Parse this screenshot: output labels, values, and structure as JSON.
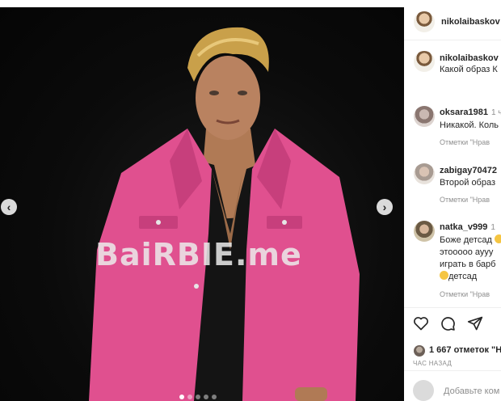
{
  "post": {
    "watermark": "BaiRBIE.me",
    "carousel": {
      "slides": 5,
      "active_index": 0
    }
  },
  "header": {
    "username": "nikolaibaskov"
  },
  "caption": {
    "username": "nikolaibaskov",
    "text": "Какой образ К"
  },
  "comments": [
    {
      "username": "oksara1981",
      "time": "1 ч",
      "text": "Никакой. Коль",
      "meta": "Отметки \"Нрав"
    },
    {
      "username": "zabigay70472",
      "time": "",
      "text": "Второй образ",
      "meta": "Отметки \"Нрав"
    },
    {
      "username": "natka_v999",
      "time": "1",
      "lines": [
        "Боже детсад",
        "этооооо аууу",
        "играть в барб",
        "детсад"
      ],
      "meta": "Отметки \"Нрав"
    }
  ],
  "actions": {
    "like_icon": "heart-icon",
    "comment_icon": "comment-icon",
    "share_icon": "send-icon"
  },
  "likes": {
    "text": "1 667 отметок \"Н"
  },
  "time_ago": "ЧАС НАЗАД",
  "add_comment": {
    "placeholder": "Добавьте ком"
  }
}
